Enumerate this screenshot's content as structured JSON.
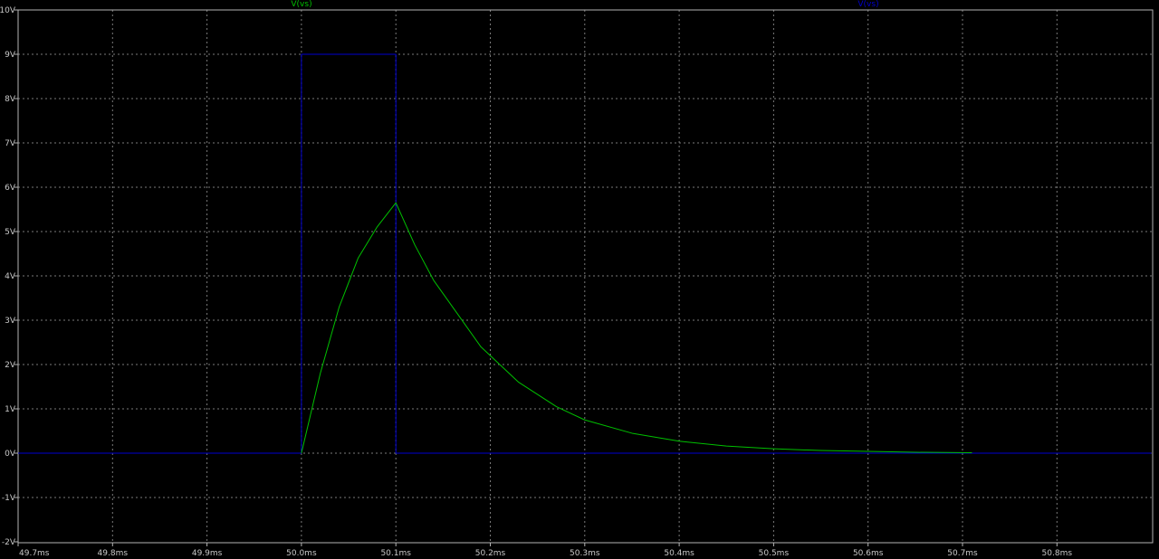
{
  "chart_data": {
    "type": "line",
    "title": "",
    "xlabel": "",
    "ylabel": "",
    "xlim": [
      49.7,
      50.9
    ],
    "ylim": [
      -2,
      10
    ],
    "grid": true,
    "background": "#000000",
    "frame_color": "#b4b4b4",
    "grid_color": "#7a7a7a",
    "x_ticks": [
      {
        "value": 49.7,
        "label": "49.7ms"
      },
      {
        "value": 49.8,
        "label": "49.8ms"
      },
      {
        "value": 49.9,
        "label": "49.9ms"
      },
      {
        "value": 50.0,
        "label": "50.0ms"
      },
      {
        "value": 50.1,
        "label": "50.1ms"
      },
      {
        "value": 50.2,
        "label": "50.2ms"
      },
      {
        "value": 50.3,
        "label": "50.3ms"
      },
      {
        "value": 50.4,
        "label": "50.4ms"
      },
      {
        "value": 50.5,
        "label": "50.5ms"
      },
      {
        "value": 50.6,
        "label": "50.6ms"
      },
      {
        "value": 50.7,
        "label": "50.7ms"
      },
      {
        "value": 50.8,
        "label": "50.8ms"
      }
    ],
    "y_ticks": [
      {
        "value": 10,
        "label": "10V"
      },
      {
        "value": 9,
        "label": "9V"
      },
      {
        "value": 8,
        "label": "8V"
      },
      {
        "value": 7,
        "label": "7V"
      },
      {
        "value": 6,
        "label": "6V"
      },
      {
        "value": 5,
        "label": "5V"
      },
      {
        "value": 4,
        "label": "4V"
      },
      {
        "value": 3,
        "label": "3V"
      },
      {
        "value": 2,
        "label": "2V"
      },
      {
        "value": 1,
        "label": "1V"
      },
      {
        "value": 0,
        "label": "0V"
      },
      {
        "value": -1,
        "label": "-1V"
      },
      {
        "value": -2,
        "label": "-2V"
      }
    ],
    "legend": [
      {
        "label": "V(vs)",
        "color": "#00c000",
        "position": "top-left"
      },
      {
        "label": "V(vs)",
        "color": "#0000d0",
        "position": "top-right"
      }
    ],
    "series": [
      {
        "color": "#0000d0",
        "x": [
          49.7,
          50.0,
          50.0,
          50.1,
          50.1,
          50.9
        ],
        "y": [
          0,
          0,
          9,
          9,
          0,
          0
        ]
      },
      {
        "color": "#00c000",
        "x": [
          50.0,
          50.02,
          50.04,
          50.06,
          50.08,
          50.1,
          50.12,
          50.14,
          50.16,
          50.19,
          50.23,
          50.27,
          50.3,
          50.35,
          50.4,
          50.45,
          50.5,
          50.55,
          50.6,
          50.65,
          50.71
        ],
        "y": [
          0,
          1.8,
          3.3,
          4.4,
          5.1,
          5.65,
          4.7,
          3.9,
          3.3,
          2.4,
          1.6,
          1.05,
          0.75,
          0.45,
          0.27,
          0.16,
          0.1,
          0.06,
          0.04,
          0.02,
          0.01
        ]
      }
    ]
  }
}
